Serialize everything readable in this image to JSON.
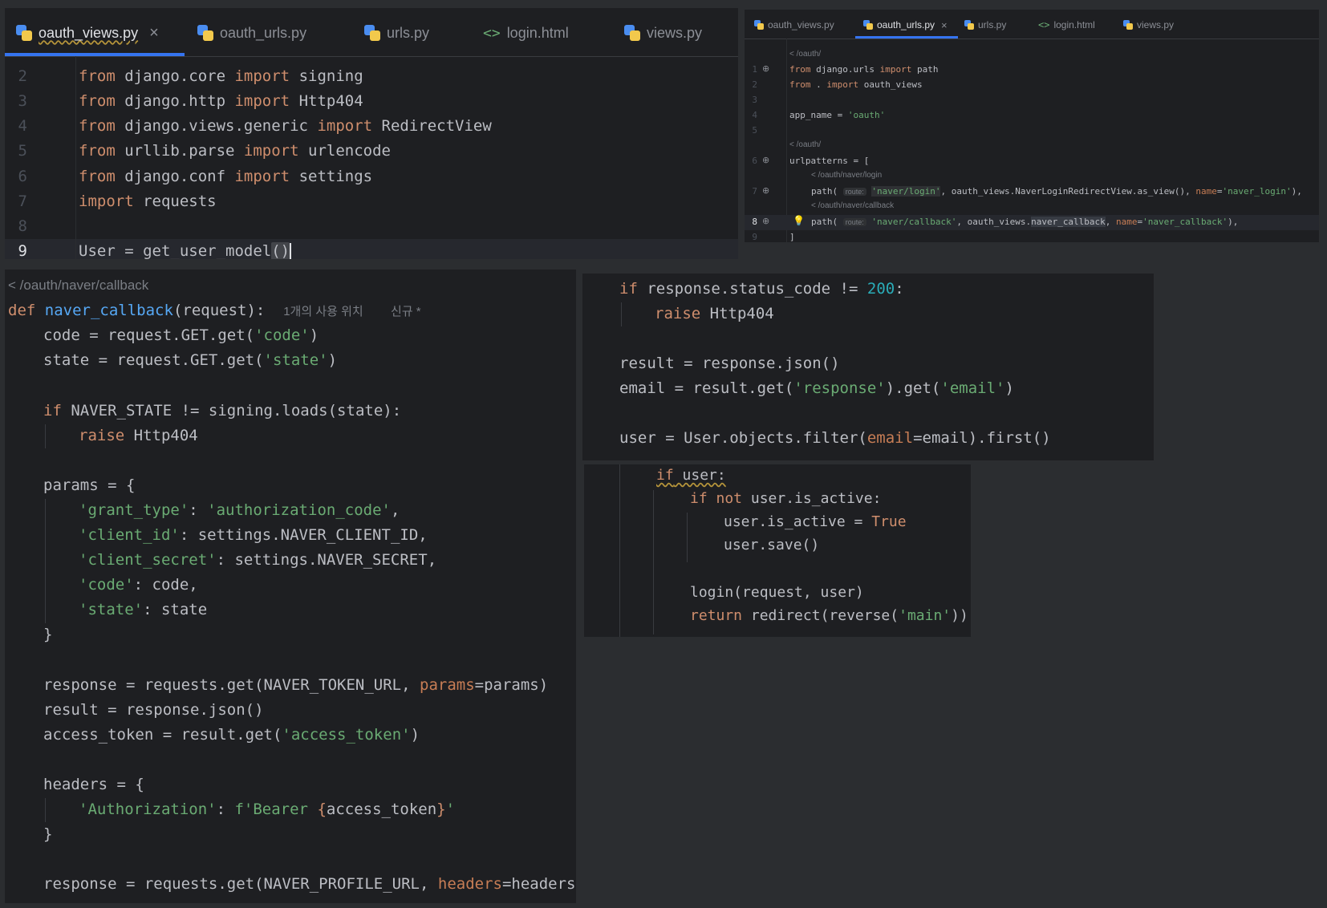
{
  "left_editor": {
    "tabs": [
      {
        "label": "oauth_views.py",
        "icon": "python-file-icon",
        "active": true
      },
      {
        "label": "oauth_urls.py",
        "icon": "python-file-icon",
        "active": false
      },
      {
        "label": "urls.py",
        "icon": "python-file-icon",
        "active": false
      },
      {
        "label": "login.html",
        "icon": "html-file-icon",
        "active": false
      },
      {
        "label": "views.py",
        "icon": "python-file-icon",
        "active": false
      }
    ],
    "close_glyph": "×",
    "line_numbers": [
      "2",
      "3",
      "4",
      "5",
      "6",
      "7",
      "8",
      "9"
    ]
  },
  "right_editor": {
    "tabs": [
      {
        "label": "oauth_views.py",
        "icon": "python-file-icon",
        "active": false
      },
      {
        "label": "oauth_urls.py",
        "icon": "python-file-icon",
        "active": true
      },
      {
        "label": "urls.py",
        "icon": "python-file-icon",
        "active": false
      },
      {
        "label": "login.html",
        "icon": "html-file-icon",
        "active": false
      },
      {
        "label": "views.py",
        "icon": "python-file-icon",
        "active": false
      }
    ],
    "close_glyph": "×",
    "line_numbers": [
      "1",
      "2",
      "3",
      "4",
      "5",
      "6",
      "7",
      "8",
      "9"
    ],
    "route_hints": [
      "/oauth/",
      "/oauth/",
      "/oauth/naver/login",
      "/oauth/naver/callback"
    ],
    "param_hint": "route:"
  },
  "callback_panel": {
    "route_hint": "/oauth/naver/callback",
    "usage_hint": "1개의 사용 위치",
    "new_hint": "신규 *"
  },
  "colors": {
    "background": "#2b2d30",
    "editor": "#1e1f22",
    "keyword": "#cf8e6d",
    "string": "#6aab73",
    "number": "#2aacb8",
    "function": "#56a8f5",
    "parameter": "#c77d55",
    "accent": "#3574f0"
  }
}
